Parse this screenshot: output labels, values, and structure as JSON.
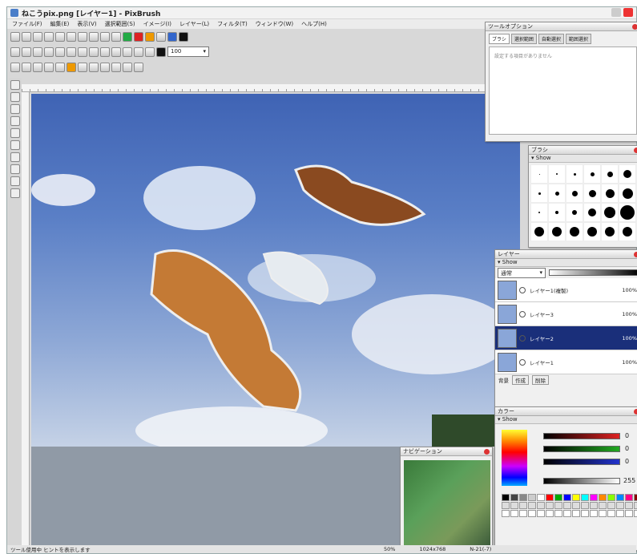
{
  "app": {
    "title": "ねこうpix.png [レイヤー1] - PixBrush",
    "icon": "app-logo-icon"
  },
  "menu": [
    "ファイル(F)",
    "編集(E)",
    "表示(V)",
    "選択範囲(S)",
    "イメージ(I)",
    "レイヤー(L)",
    "フィルタ(T)",
    "ウィンドウ(W)",
    "ヘルプ(H)"
  ],
  "toolbar": {
    "zoom_value": "100"
  },
  "tool_options": {
    "title": "ツールオプション",
    "tabs": [
      "ブラシ",
      "選択範囲",
      "自動選択",
      "範囲選択"
    ],
    "hint": "設定する項目がありません"
  },
  "brushes": {
    "title": "ブラシ",
    "subheader": "Show"
  },
  "layers": {
    "title": "レイヤー",
    "subheader": "Show",
    "blend_mode": "通常",
    "items": [
      {
        "name": "レイヤー1(複製)",
        "opacity": "100%",
        "selected": false
      },
      {
        "name": "レイヤー3",
        "opacity": "100%",
        "selected": false
      },
      {
        "name": "レイヤー2",
        "opacity": "100%",
        "selected": true
      },
      {
        "name": "レイヤー1",
        "opacity": "100%",
        "selected": false
      }
    ],
    "footer": {
      "lock": "背景",
      "new_label": "作成",
      "delete_label": "削除"
    }
  },
  "color": {
    "title": "カラー",
    "subheader": "Show",
    "r": "0",
    "g": "0",
    "b": "0",
    "alpha": "255",
    "accent": "#1a2f7a"
  },
  "navigator": {
    "title": "ナビゲーション"
  },
  "status": {
    "message": "ツール使用中 ヒントを表示します",
    "zoom": "50%",
    "size": "1024x768",
    "coords": "N-21(-7)"
  }
}
